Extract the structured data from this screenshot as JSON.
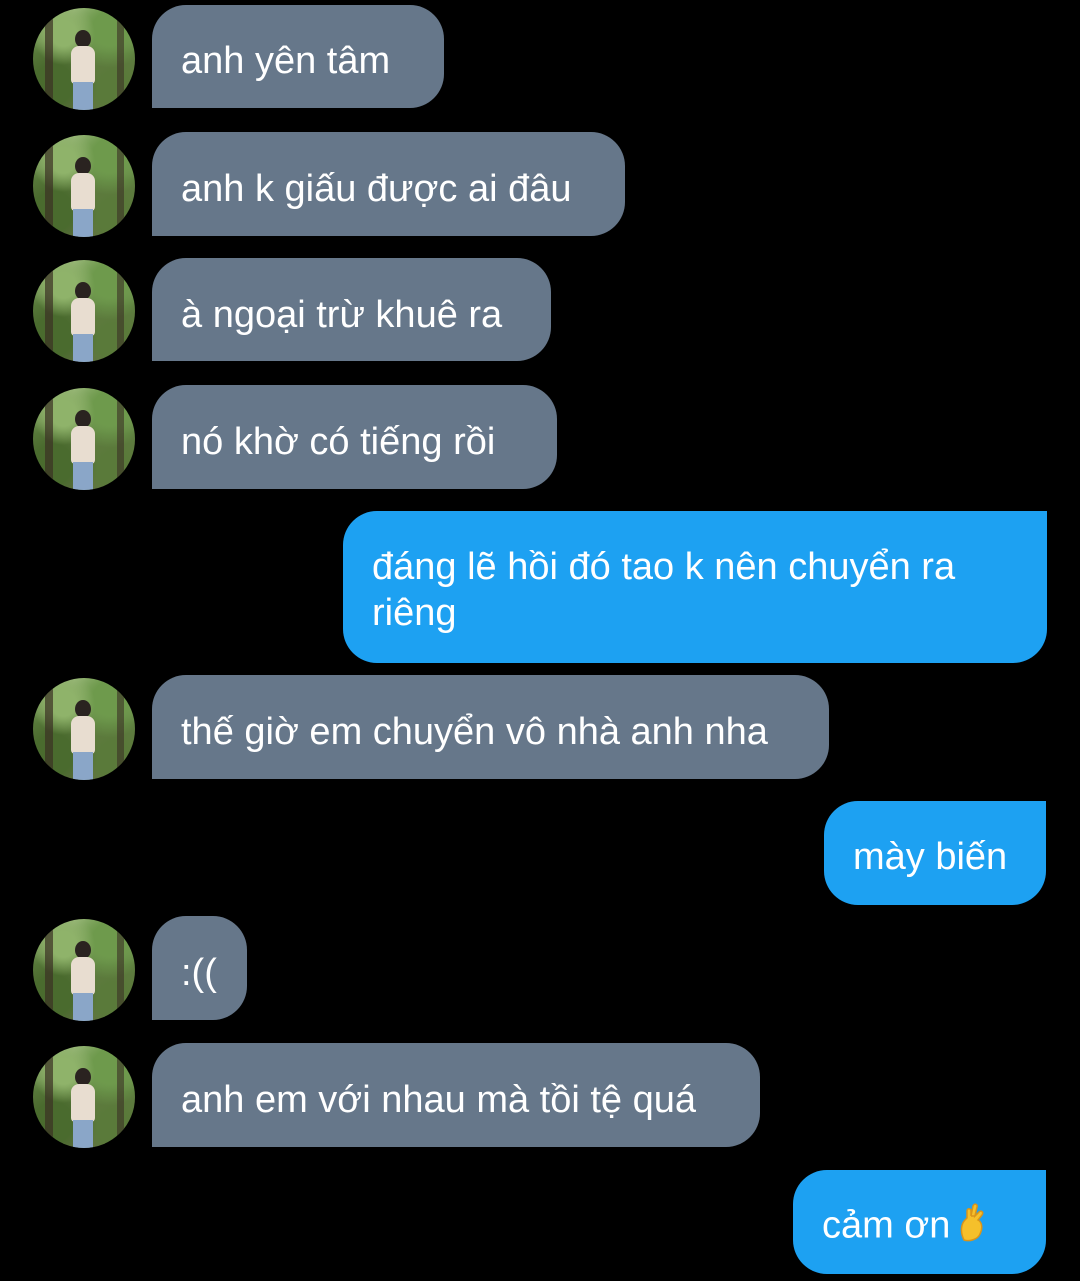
{
  "messages": [
    {
      "sender": "contact",
      "text": "anh yên tâm"
    },
    {
      "sender": "contact",
      "text": "anh k giấu được ai đâu"
    },
    {
      "sender": "contact",
      "text": "à ngoại trừ khuê ra"
    },
    {
      "sender": "contact",
      "text": "nó khờ có tiếng rồi"
    },
    {
      "sender": "me",
      "text": "đáng lẽ hồi đó tao k nên chuyển ra riêng"
    },
    {
      "sender": "contact",
      "text": "thế giờ em chuyển vô nhà anh nha"
    },
    {
      "sender": "me",
      "text": "mày biến"
    },
    {
      "sender": "contact",
      "text": ":(("
    },
    {
      "sender": "contact",
      "text": "anh em với nhau mà tồi tệ quá"
    },
    {
      "sender": "me",
      "text": "cảm ơn",
      "emoji": "crossed-fingers-icon"
    }
  ],
  "colors": {
    "background": "#000000",
    "incoming_bubble": "#66778a",
    "outgoing_bubble": "#1da1f2",
    "text": "#ffffff"
  }
}
